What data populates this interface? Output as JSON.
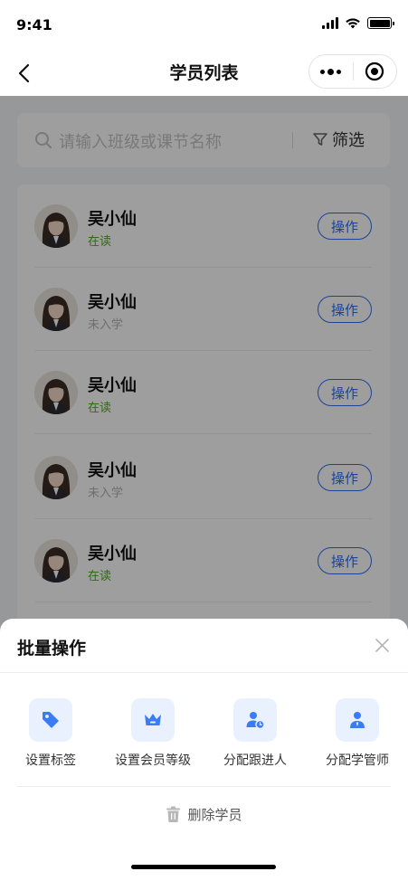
{
  "status_bar": {
    "time": "9:41"
  },
  "nav": {
    "title": "学员列表"
  },
  "search": {
    "placeholder": "请输入班级或课节名称",
    "filter_label": "筛选"
  },
  "colors": {
    "accent": "#2f6df0",
    "status_active": "#52a726",
    "status_pending": "#b3b3b3",
    "icon_bg": "#eaf1fe"
  },
  "students": [
    {
      "name": "吴小仙",
      "status": "在读",
      "status_type": "active",
      "action_label": "操作"
    },
    {
      "name": "吴小仙",
      "status": "未入学",
      "status_type": "pending",
      "action_label": "操作"
    },
    {
      "name": "吴小仙",
      "status": "在读",
      "status_type": "active",
      "action_label": "操作"
    },
    {
      "name": "吴小仙",
      "status": "未入学",
      "status_type": "pending",
      "action_label": "操作"
    },
    {
      "name": "吴小仙",
      "status": "在读",
      "status_type": "active",
      "action_label": "操作"
    }
  ],
  "sheet": {
    "title": "批量操作",
    "actions": [
      {
        "label": "设置标签",
        "icon": "tag-icon"
      },
      {
        "label": "设置会员等级",
        "icon": "crown-icon"
      },
      {
        "label": "分配跟进人",
        "icon": "user-clock-icon"
      },
      {
        "label": "分配学管师",
        "icon": "user-tie-icon"
      }
    ],
    "delete_label": "删除学员"
  }
}
